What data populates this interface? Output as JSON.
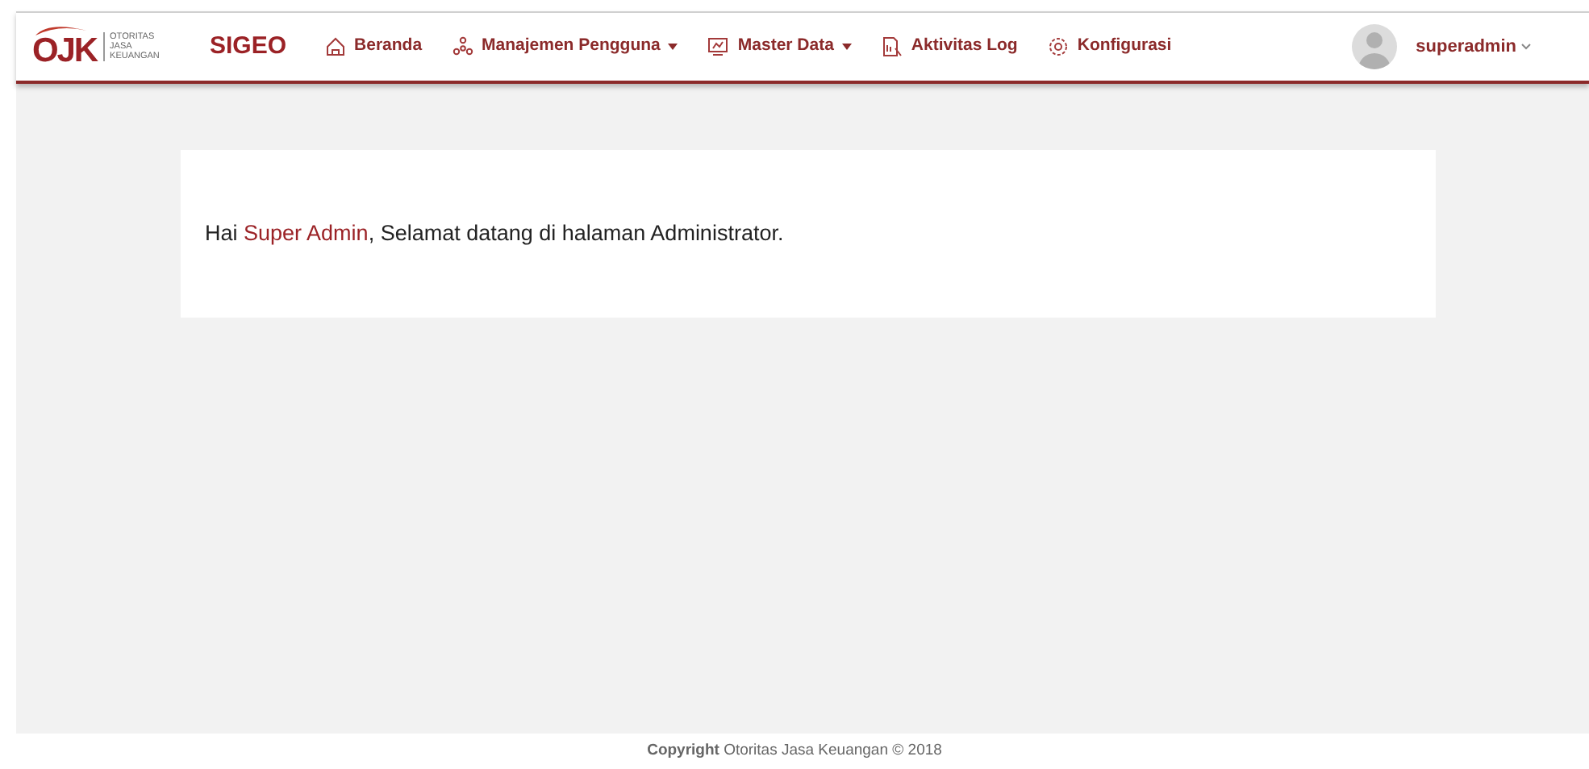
{
  "logo": {
    "mark": "OJK",
    "lines": [
      "OTORITAS",
      "JASA",
      "KEUANGAN"
    ]
  },
  "app_title": "SIGEO",
  "nav": [
    {
      "label": "Beranda",
      "kind": "home",
      "dropdown": false
    },
    {
      "label": "Manajemen Pengguna",
      "kind": "users",
      "dropdown": true
    },
    {
      "label": "Master Data",
      "kind": "monitor",
      "dropdown": true
    },
    {
      "label": "Aktivitas Log",
      "kind": "report",
      "dropdown": false
    },
    {
      "label": "Konfigurasi",
      "kind": "gear",
      "dropdown": false
    }
  ],
  "user": {
    "name": "superadmin"
  },
  "welcome": {
    "before": "Hai ",
    "name": "Super Admin",
    "after": ", Selamat datang di halaman Administrator."
  },
  "footer": "**Copyright** Otoritas Jasa Keuangan © 2018"
}
